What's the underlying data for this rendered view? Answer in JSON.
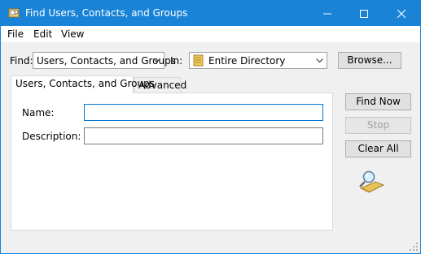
{
  "window": {
    "title": "Find Users, Contacts, and Groups",
    "accent": "#1883d7"
  },
  "titlebar_icons": {
    "app": "find-app-icon",
    "minimize": "minimize-icon",
    "maximize": "maximize-icon",
    "close": "close-icon"
  },
  "menu": {
    "items": [
      "File",
      "Edit",
      "View"
    ]
  },
  "search": {
    "find_label": "Find:",
    "find_value": "Users, Contacts, and Groups",
    "in_label": "In:",
    "in_value": "Entire Directory",
    "browse_label": "Browse..."
  },
  "tabs": [
    "Users, Contacts, and Groups",
    "Advanced"
  ],
  "form": {
    "name_label": "Name:",
    "name_value": "",
    "description_label": "Description:",
    "description_value": ""
  },
  "actions": {
    "find_now": "Find Now",
    "stop": "Stop",
    "clear_all": "Clear All"
  }
}
